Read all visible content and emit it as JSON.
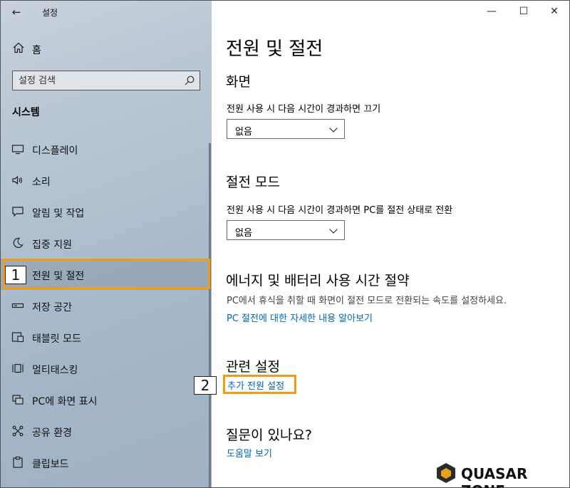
{
  "window": {
    "app_title": "설정",
    "back_glyph": "←",
    "minimize_glyph": "—",
    "maximize_glyph": "☐",
    "close_glyph": "✕"
  },
  "sidebar": {
    "home_label": "홈",
    "search_placeholder": "설정 검색",
    "section_title": "시스템",
    "items": [
      {
        "label": "디스플레이",
        "icon": "monitor-icon"
      },
      {
        "label": "소리",
        "icon": "speaker-icon"
      },
      {
        "label": "알림 및 작업",
        "icon": "notification-icon"
      },
      {
        "label": "집중 지원",
        "icon": "moon-icon"
      },
      {
        "label": "전원 및 절전",
        "icon": "power-icon",
        "selected": true
      },
      {
        "label": "저장 공간",
        "icon": "storage-icon"
      },
      {
        "label": "태블릿 모드",
        "icon": "tablet-icon"
      },
      {
        "label": "멀티태스킹",
        "icon": "multitask-icon"
      },
      {
        "label": "PC에 화면 표시",
        "icon": "project-icon"
      },
      {
        "label": "공유 환경",
        "icon": "share-icon"
      },
      {
        "label": "클립보드",
        "icon": "clipboard-icon"
      }
    ]
  },
  "annotations": {
    "badge1": "1",
    "badge2": "2"
  },
  "main": {
    "title": "전원 및 절전",
    "screen": {
      "heading": "화면",
      "label": "전원 사용 시 다음 시간이 경과하면 끄기",
      "value": "없음"
    },
    "sleep": {
      "heading": "절전 모드",
      "label": "전원 사용 시 다음 시간이 경과하면 PC를 절전 상태로 전환",
      "value": "없음"
    },
    "energy": {
      "heading": "에너지 및 배터리 사용 시간 절약",
      "desc": "PC에서 휴식을 취할 때 화면이 절전 모드로 전환되는 속도를 설정하세요.",
      "link": "PC 절전에 대한 자세한 내용 알아보기"
    },
    "related": {
      "heading": "관련 설정",
      "link": "추가 전원 설정"
    },
    "question": {
      "heading": "질문이 있나요?",
      "link": "도움말 보기"
    }
  },
  "watermark": {
    "text": "QUASAR ZONE"
  },
  "colors": {
    "accent_link": "#0067b8",
    "highlight_orange": "#f29b15"
  }
}
